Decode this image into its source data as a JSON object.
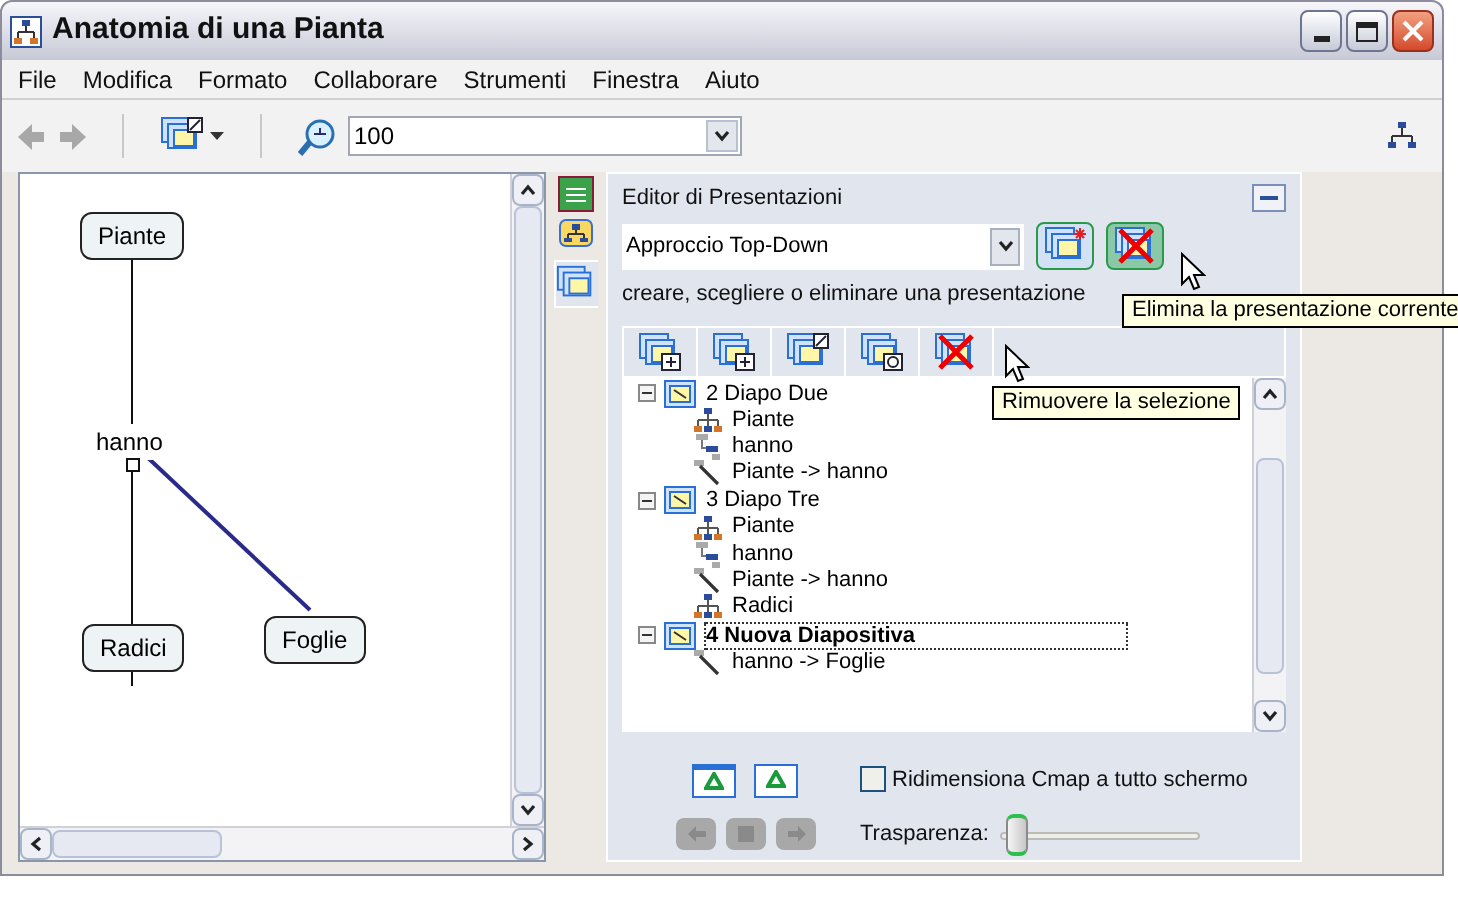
{
  "window": {
    "title": "Anatomia di una Pianta"
  },
  "menu": [
    {
      "label": "File"
    },
    {
      "label": "Modifica"
    },
    {
      "label": "Formato"
    },
    {
      "label": "Collaborare"
    },
    {
      "label": "Strumenti"
    },
    {
      "label": "Finestra"
    },
    {
      "label": "Aiuto"
    }
  ],
  "toolbar": {
    "zoom": "100"
  },
  "map": {
    "nodes": [
      {
        "label": "Piante",
        "kind": "concept"
      },
      {
        "label": "hanno",
        "kind": "linking"
      },
      {
        "label": "Radici",
        "kind": "concept"
      },
      {
        "label": "Foglie",
        "kind": "concept"
      }
    ]
  },
  "panel": {
    "title": "Editor di Presentazioni",
    "presentation": "Approccio Top-Down",
    "hint": "creare, scegliere o eliminare una presentazione",
    "delete_tooltip": "Elimina la presentazione corrente",
    "remove_tooltip": "Rimuovere la selezione",
    "slides": [
      {
        "label": "2 Diapo Due",
        "selected": false,
        "children": [
          {
            "label": "Piante",
            "kind": "concept"
          },
          {
            "label": "hanno",
            "kind": "linking"
          },
          {
            "label": "Piante -> hanno",
            "kind": "connection"
          }
        ]
      },
      {
        "label": "3 Diapo Tre",
        "selected": false,
        "children": [
          {
            "label": "Piante",
            "kind": "concept"
          },
          {
            "label": "hanno",
            "kind": "linking"
          },
          {
            "label": "Piante -> hanno",
            "kind": "connection"
          },
          {
            "label": "Radici",
            "kind": "concept"
          }
        ]
      },
      {
        "label": "4 Nuova Diapositiva",
        "selected": true,
        "children": [
          {
            "label": "hanno -> Foglie",
            "kind": "connection"
          }
        ]
      }
    ],
    "fullscreen": {
      "label": "Ridimensiona Cmap a tutto schermo",
      "checked": false
    },
    "transparency": {
      "label": "Trasparenza:",
      "level": 0.03
    }
  }
}
